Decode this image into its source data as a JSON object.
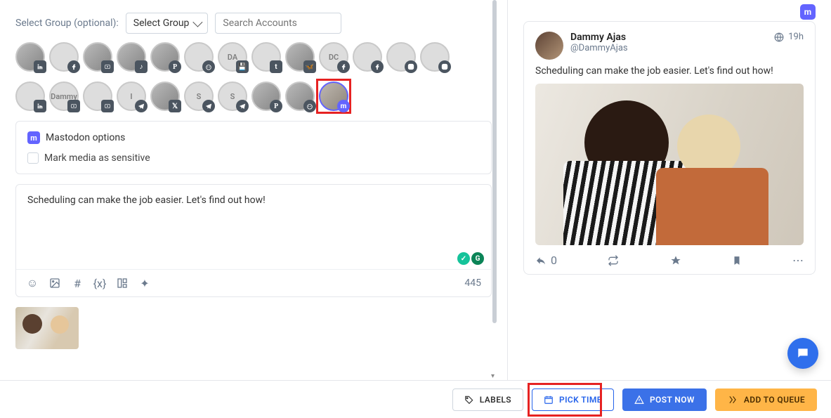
{
  "composer": {
    "group_label": "Select Group (optional):",
    "select_group_label": "Select Group",
    "search_placeholder": "Search Accounts",
    "options_title": "Mastodon options",
    "sensitive_label": "Mark media as sensitive",
    "text": "Scheduling can make the job easier. Let's find out how!",
    "char_count": "445"
  },
  "avatars_row1": [
    {
      "type": "person",
      "badge": "linkedin"
    },
    {
      "type": "logo",
      "badge": "facebook"
    },
    {
      "type": "person",
      "badge": "youtube"
    },
    {
      "type": "person",
      "badge": "tiktok"
    },
    {
      "type": "person",
      "badge": "pinterest"
    },
    {
      "type": "logo",
      "badge": "reddit"
    },
    {
      "type": "label",
      "text": "DA",
      "badge": "save"
    },
    {
      "type": "logo",
      "badge": "tumblr"
    },
    {
      "type": "person",
      "badge": "bluesky"
    },
    {
      "type": "label",
      "text": "DC",
      "badge": "facebook"
    },
    {
      "type": "logo",
      "badge": "facebook"
    },
    {
      "type": "logo",
      "badge": "instagram"
    },
    {
      "type": "logo",
      "badge": "instagram"
    }
  ],
  "avatars_row2": [
    {
      "type": "logo",
      "badge": "linkedin"
    },
    {
      "type": "logo",
      "text": "Dammy",
      "badge": "youtube"
    },
    {
      "type": "logo",
      "badge": "youtube"
    },
    {
      "type": "label",
      "text": "I",
      "badge": "telegram"
    },
    {
      "type": "person",
      "badge": "x"
    },
    {
      "type": "label",
      "text": "S",
      "badge": "telegram"
    },
    {
      "type": "label",
      "text": "S",
      "badge": "telegram"
    },
    {
      "type": "person",
      "badge": "pinterest"
    },
    {
      "type": "person",
      "badge": "reddit"
    },
    {
      "type": "person",
      "badge": "mastodon",
      "selected": true
    }
  ],
  "preview": {
    "name": "Dammy Ajas",
    "handle": "@DammyAjas",
    "time": "19h",
    "text": "Scheduling can make the job easier. Let's find out how!",
    "reply_count": "0"
  },
  "buttons": {
    "labels": "LABELS",
    "pick_time": "PICK TIME",
    "post_now": "POST NOW",
    "add_queue": "ADD TO QUEUE"
  }
}
